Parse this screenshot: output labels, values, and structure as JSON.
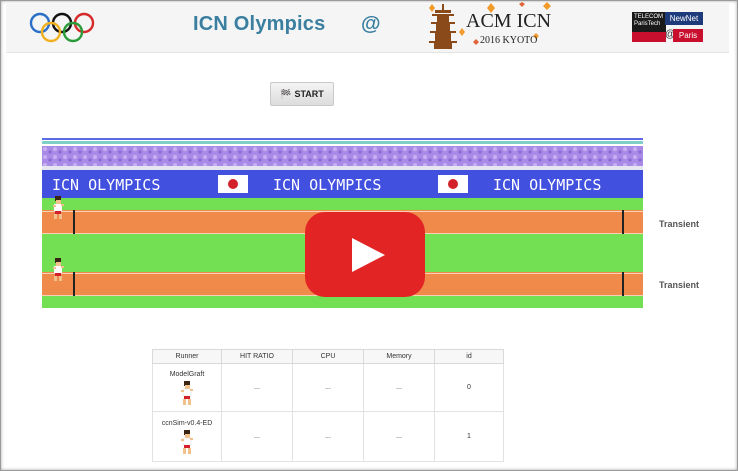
{
  "header": {
    "title": "ICN Olympics",
    "at": "@",
    "conference_name": "ACM ICN",
    "conference_sub": "2016 KYOTO",
    "telecom_line1": "TELECOM",
    "telecom_line2": "ParisTech",
    "newnet": "NewNet",
    "at_small": "@",
    "paris": "Paris"
  },
  "toolbar": {
    "start_label": "START",
    "start_icon": "checkered-flag-icon"
  },
  "banner": {
    "text": "ICN OLYMPICS",
    "flag": "japan-flag"
  },
  "lanes": [
    {
      "label": "Transient"
    },
    {
      "label": "Transient"
    }
  ],
  "table": {
    "headers": [
      "Runner",
      "HIT RATIO",
      "CPU",
      "Memory",
      "id"
    ],
    "rows": [
      {
        "runner": "ModelGraft",
        "hit_ratio": "...",
        "cpu": "...",
        "memory": "...",
        "id": "0"
      },
      {
        "runner": "ccnSim-v0.4-ED",
        "hit_ratio": "...",
        "cpu": "...",
        "memory": "...",
        "id": "1"
      }
    ]
  },
  "colors": {
    "title": "#3a7fa0",
    "banner_bg": "#4250e0",
    "track": "#f08a4a",
    "grass": "#72e052",
    "stands": "#a98ae6",
    "play_button": "#e32424"
  }
}
